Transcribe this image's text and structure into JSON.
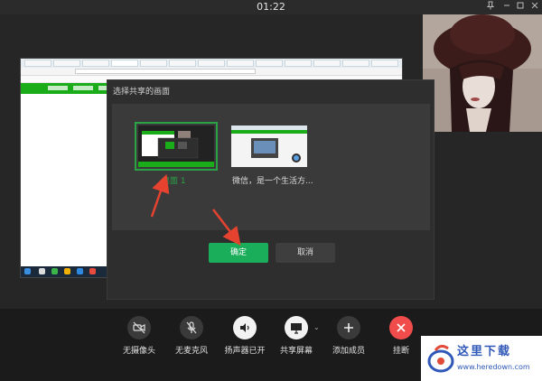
{
  "titlebar": {
    "time": "01:22",
    "pin_icon": "pin-icon",
    "minimize_icon": "minimize-icon",
    "maximize_icon": "maximize-icon",
    "close_icon": "close-icon"
  },
  "dialog": {
    "title": "选择共享的画面",
    "options": [
      {
        "label": "桌面 1",
        "selected": true
      },
      {
        "label": "微信，是一个生活方...",
        "selected": false
      }
    ],
    "confirm_label": "确定",
    "cancel_label": "取消"
  },
  "toolbar": {
    "items": [
      {
        "label": "无摄像头",
        "icon": "camera-off-icon"
      },
      {
        "label": "无麦克风",
        "icon": "mic-off-icon"
      },
      {
        "label": "扬声器已开",
        "icon": "speaker-icon"
      },
      {
        "label": "共享屏幕",
        "icon": "screen-share-icon"
      },
      {
        "label": "添加成员",
        "icon": "add-member-icon"
      },
      {
        "label": "挂断",
        "icon": "hangup-icon"
      }
    ]
  },
  "watermark": {
    "title": "这里下载",
    "url": "www.heredown.com"
  },
  "colors": {
    "accent_green": "#1aad5a",
    "selection_green": "#2ba245",
    "hangup_red": "#f04c4c",
    "arrow_red": "#e5432f",
    "watermark_blue": "#2f58b8"
  }
}
